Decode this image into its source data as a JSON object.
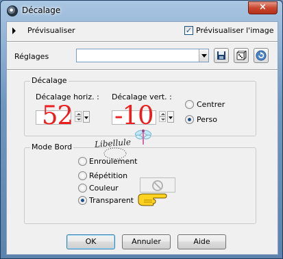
{
  "window": {
    "title": "Décalage",
    "close_glyph": "×"
  },
  "preview_bar": {
    "toggle_label": "Prévisualiser",
    "checkbox_label": "Prévisualiser l'image",
    "checkbox_checked": true,
    "check_glyph": "✓"
  },
  "presets": {
    "label": "Réglages",
    "value": "",
    "icons": [
      "save-icon",
      "dice-icon",
      "reset-icon"
    ]
  },
  "offset_group": {
    "title": "Décalage",
    "horizontal_label": "Décalage horiz. :",
    "horizontal_value": "52",
    "vertical_label": "Décalage vert. :",
    "vertical_value": "-10",
    "center_label": "Centrer",
    "custom_label": "Perso",
    "selected": "Perso"
  },
  "edge_group": {
    "title": "Mode Bord",
    "options": [
      "Enroulement",
      "Répétition",
      "Couleur",
      "Transparent"
    ],
    "selected": "Transparent"
  },
  "watermark": {
    "text": "Libellule"
  },
  "buttons": {
    "ok": "OK",
    "cancel": "Annuler",
    "help": "Aide"
  },
  "colors": {
    "value_red": "#ee1c1c",
    "accent_blue": "#1f4f86"
  }
}
